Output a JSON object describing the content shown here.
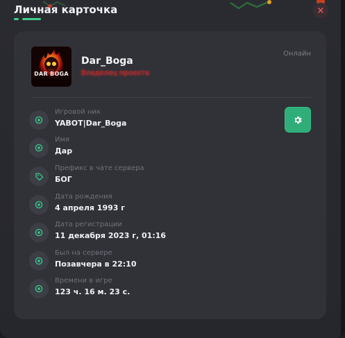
{
  "header": {
    "title": "Личная карточка",
    "close_label": "×"
  },
  "profile": {
    "username": "Dar_Boga",
    "role": "Владелец проекта",
    "status": "Онлайн",
    "avatar_text": "DAR BOGA"
  },
  "fields": [
    {
      "label": "Игровой ник",
      "value": "YABOT|Dar_Boga",
      "icon": "dot-circle-icon"
    },
    {
      "label": "Имя",
      "value": "Дар",
      "icon": "dot-circle-icon"
    },
    {
      "label": "Префикс в чате сервера",
      "value": "БОГ",
      "icon": "tag-icon"
    },
    {
      "label": "Дата рождения",
      "value": "4 апреля 1993 г",
      "icon": "dot-circle-icon"
    },
    {
      "label": "Дата регистрации",
      "value": "11 декабря 2023 г, 01:16",
      "icon": "dot-circle-icon"
    },
    {
      "label": "Был на сервере",
      "value": "Позавчера в 22:10",
      "icon": "dot-circle-icon"
    },
    {
      "label": "Времени в игре",
      "value": "123 ч. 16 м. 23 с.",
      "icon": "dot-circle-icon"
    }
  ],
  "colors": {
    "accent": "#3fd08f",
    "settings_button": "#2fae7a",
    "role": "#e33232",
    "card": "#313238"
  }
}
